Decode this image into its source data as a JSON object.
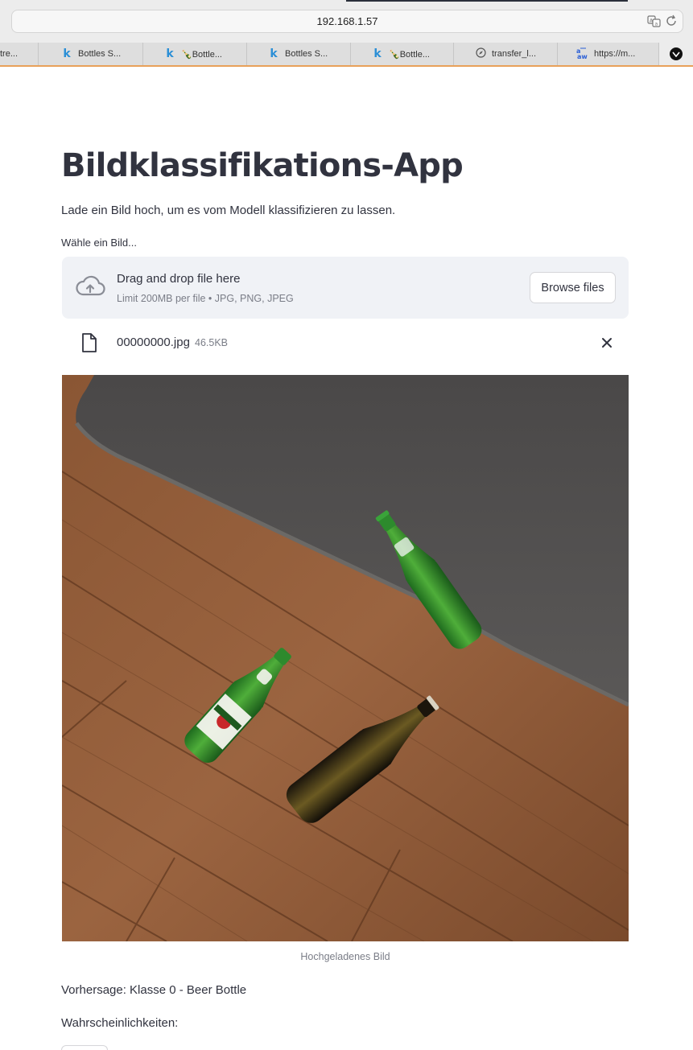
{
  "browser": {
    "address": "192.168.1.57",
    "tabs": [
      {
        "icon": "none",
        "label": "tre..."
      },
      {
        "icon": "kaggle-icon",
        "label": "Bottles S..."
      },
      {
        "icon": "bottle-icon",
        "label": "🍾Bottle..."
      },
      {
        "icon": "kaggle-icon",
        "label": "Bottles S..."
      },
      {
        "icon": "bottle-icon",
        "label": "🍾Bottle..."
      },
      {
        "icon": "compass-icon",
        "label": "transfer_l..."
      },
      {
        "icon": "aw-icon",
        "label": "https://m..."
      }
    ]
  },
  "app": {
    "title": "Bildklassifikations-App",
    "subtitle": "Lade ein Bild hoch, um es vom Modell klassifizieren zu lassen.",
    "uploader_label": "Wähle ein Bild...",
    "dropzone_title": "Drag and drop file here",
    "dropzone_limit": "Limit 200MB per file • JPG, PNG, JPEG",
    "browse_label": "Browse files",
    "file": {
      "name": "00000000.jpg",
      "size": "46.5KB"
    },
    "image_caption": "Hochgeladenes Bild",
    "prediction": "Vorhersage: Klasse 0 - Beer Bottle",
    "probabilities_label": "Wahrscheinlichkeiten:"
  },
  "colors": {
    "text": "#31333f",
    "muted": "#7a7d87",
    "dropzone_bg": "#f0f2f6",
    "tab_accent": "#e8a15a"
  }
}
